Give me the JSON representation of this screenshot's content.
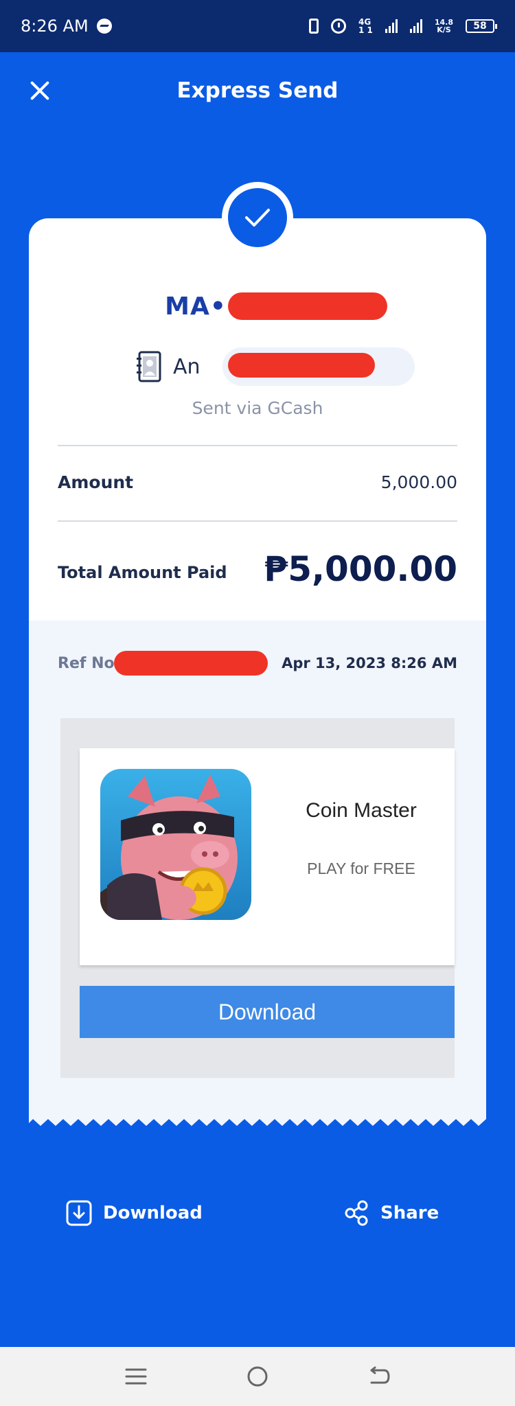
{
  "status_bar": {
    "time": "8:26 AM",
    "network": "4G",
    "network_sub": "1 1",
    "speed_value": "14.8",
    "speed_unit": "K/S",
    "battery": "58"
  },
  "header": {
    "title": "Express Send"
  },
  "receipt": {
    "recipient_name": "MA•",
    "contact_name": "An",
    "sent_via": "Sent via GCash",
    "amount_label": "Amount",
    "amount_value": "5,000.00",
    "total_label": "Total Amount Paid",
    "total_value": "₱5,000.00",
    "ref_label": "Ref No.",
    "date": "Apr 13, 2023 8:26 AM"
  },
  "ad": {
    "app_name": "Coin Master",
    "tagline": "PLAY for FREE",
    "button_label": "Download"
  },
  "actions": {
    "download_label": "Download",
    "share_label": "Share"
  },
  "colors": {
    "primary": "#0a5ce5",
    "status_bar": "#0c2a6e",
    "redaction": "#ef3326",
    "ad_button": "#3e8ae6"
  },
  "icons": [
    "messenger-icon",
    "vibrate-icon",
    "alarm-icon",
    "signal-icon",
    "battery-icon",
    "close-icon",
    "check-icon",
    "contact-book-icon",
    "download-icon",
    "share-icon",
    "recents-icon",
    "home-icon",
    "back-icon"
  ]
}
